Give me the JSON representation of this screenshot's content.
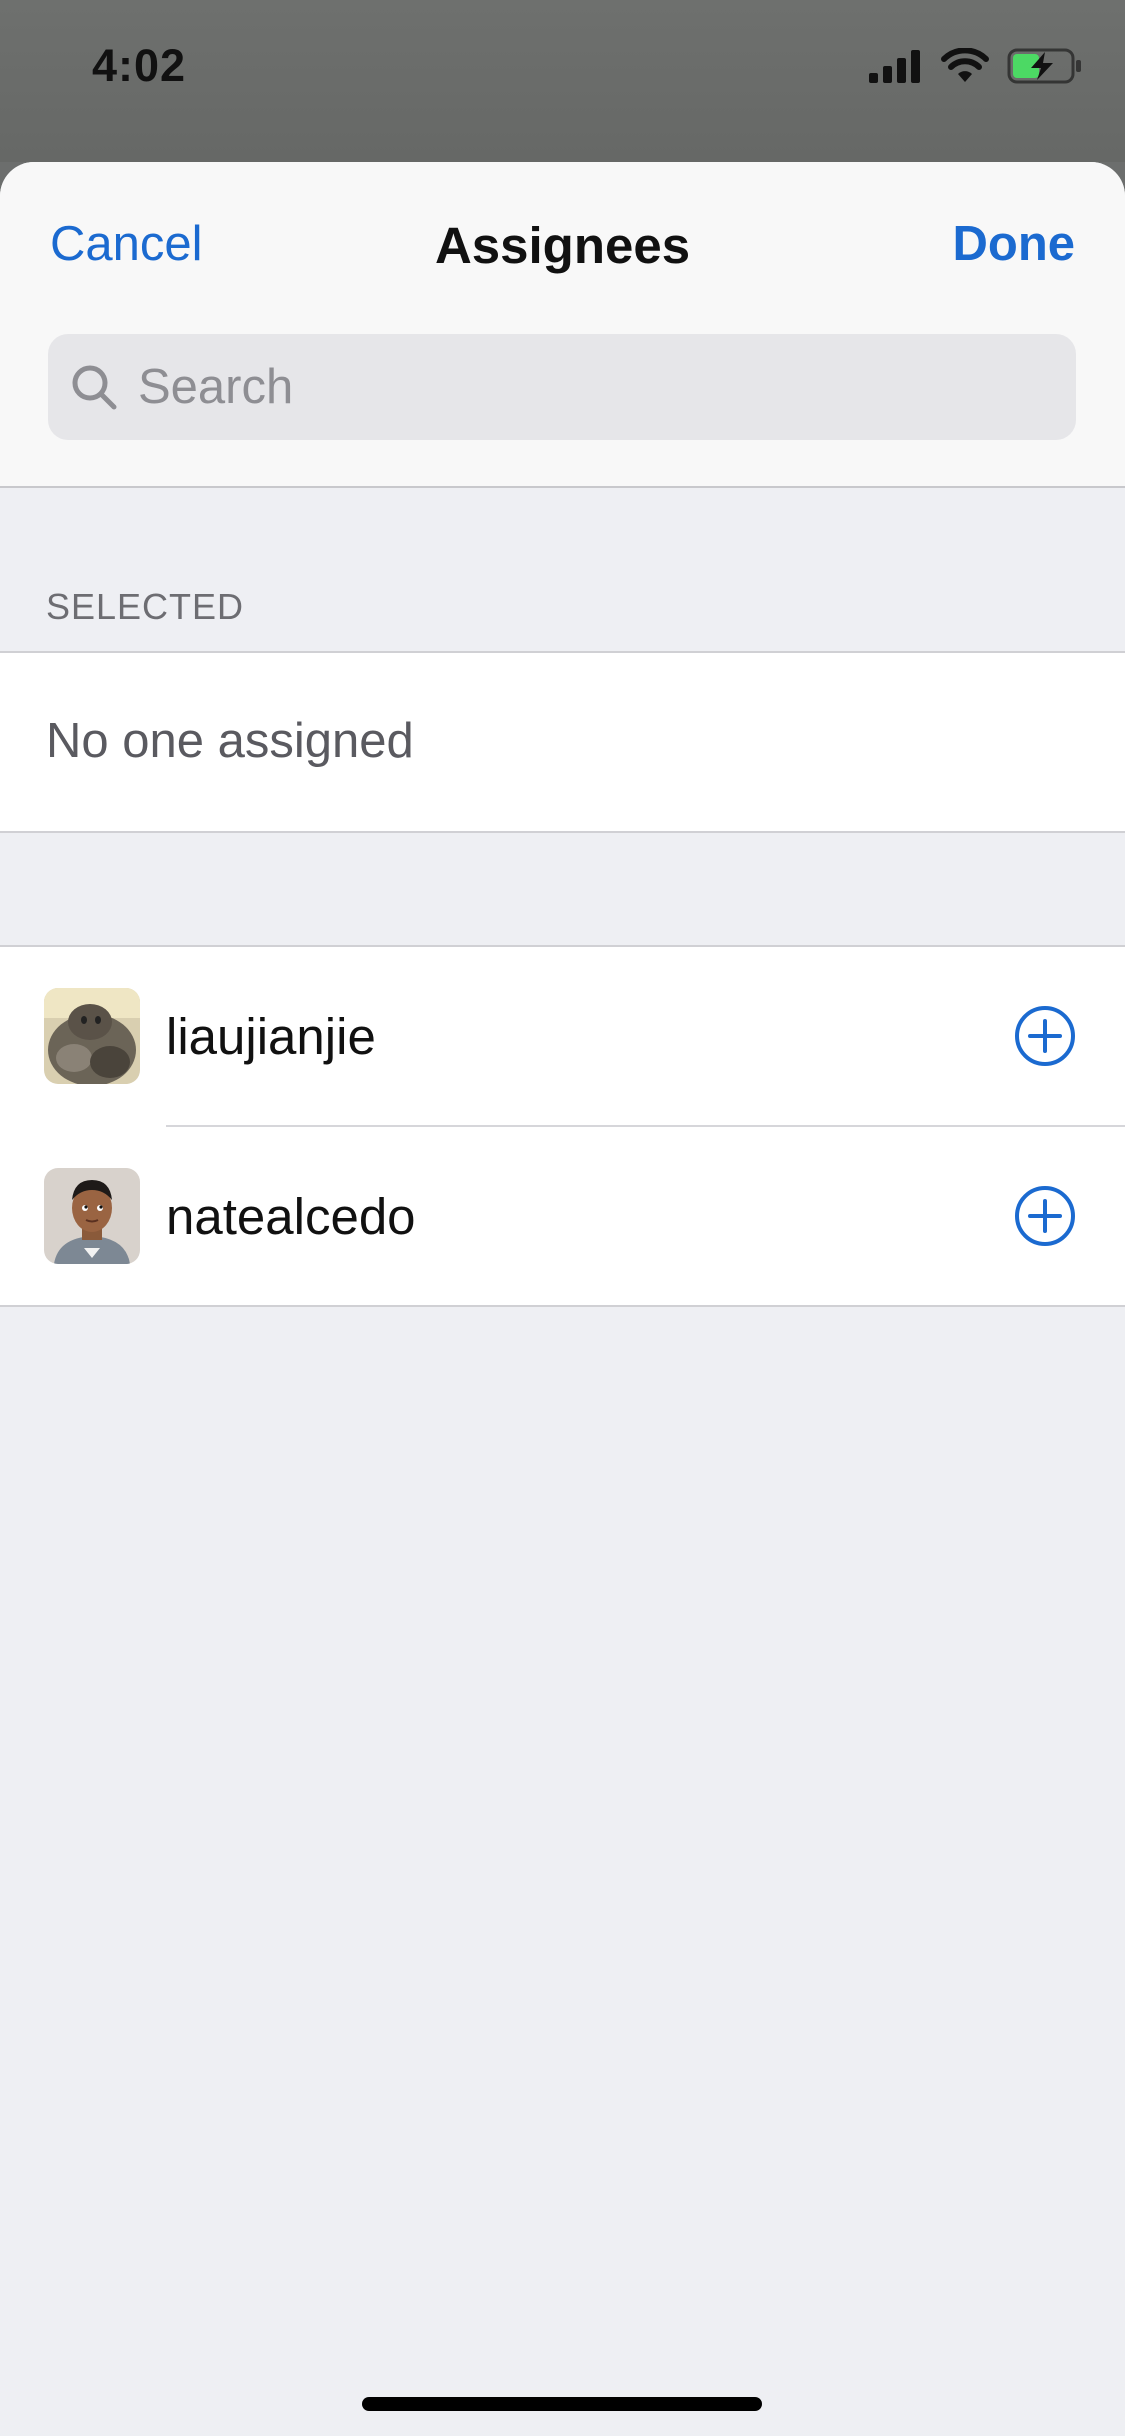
{
  "status_bar": {
    "time": "4:02",
    "icons": [
      "cellular-signal-icon",
      "wifi-icon",
      "battery-charging-icon"
    ]
  },
  "nav": {
    "cancel_label": "Cancel",
    "title": "Assignees",
    "done_label": "Done"
  },
  "search": {
    "placeholder": "Search",
    "value": ""
  },
  "selected_section": {
    "header": "SELECTED",
    "empty_label": "No one assigned"
  },
  "users": [
    {
      "name": "liaujianjie",
      "action_icon": "add-circle-icon"
    },
    {
      "name": "natealcedo",
      "action_icon": "add-circle-icon"
    }
  ],
  "colors": {
    "accent": "#1b6ad0",
    "sheet_background": "#eeeff3",
    "nav_background": "#f8f8f8",
    "status_bar_background": "#6e706e",
    "battery_charging": "#4cd964"
  }
}
